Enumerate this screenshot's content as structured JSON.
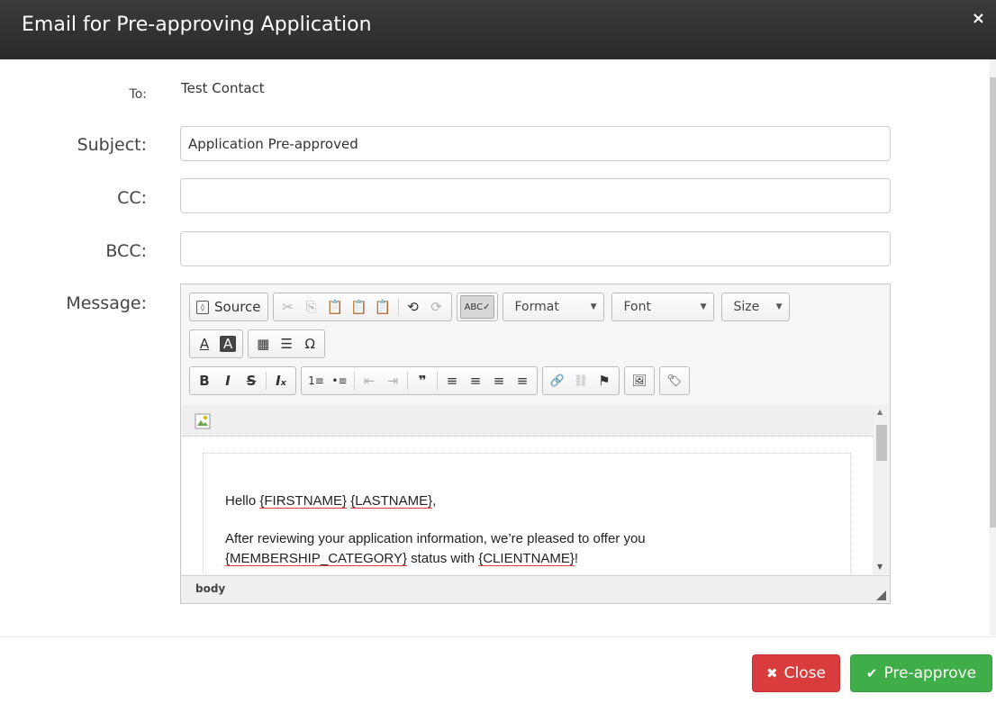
{
  "modal": {
    "title": "Email for Pre-approving Application",
    "close_symbol": "×"
  },
  "form": {
    "to_label": "To:",
    "to_value": "Test Contact",
    "subject_label": "Subject:",
    "subject_value": "Application Pre-approved",
    "cc_label": "CC:",
    "cc_value": "",
    "bcc_label": "BCC:",
    "bcc_value": "",
    "message_label": "Message:"
  },
  "editor": {
    "source_label": "Source",
    "format_label": "Format",
    "font_label": "Font",
    "size_label": "Size",
    "path": "body",
    "body": {
      "greeting_prefix": "Hello ",
      "firstname": "{FIRSTNAME}",
      "space": " ",
      "lastname": "{LASTNAME}",
      "greeting_suffix": ",",
      "line2": "After reviewing your application information, we’re pleased to offer you",
      "membership": "{MEMBERSHIP_CATEGORY}",
      "status_with": " status with ",
      "clientname": "{CLIENTNAME}",
      "ending": "!"
    }
  },
  "icons": {
    "cut": "✂",
    "copy": "⎘",
    "paste": "📋",
    "undo": "⟲",
    "redo": "⟳",
    "bold": "B",
    "italic": "I",
    "strike": "S",
    "remove_format": "Iₓ",
    "numbered_list": "1≡",
    "bulleted_list": "•≡",
    "outdent": "⇤",
    "indent": "⇥",
    "blockquote": "❞",
    "align_left": "≡",
    "align_center": "≡",
    "align_right": "≡",
    "justify": "≡",
    "link": "🔗",
    "unlink": "⛓",
    "anchor": "⚑",
    "table": "▦",
    "hr": "☰",
    "special_char": "Ω",
    "text_color": "A",
    "bg_color": "A",
    "spellcheck": "ABC✓",
    "image": "🖼",
    "tag": "🏷"
  },
  "buttons": {
    "close_label": "Close",
    "close_icon": "✖",
    "approve_label": "Pre-approve",
    "approve_icon": "✔"
  },
  "colors": {
    "header_bg": "#2f2f2f",
    "close_btn": "#d93c3c",
    "approve_btn": "#3fae49",
    "spell_underline": "#e23a3a"
  }
}
